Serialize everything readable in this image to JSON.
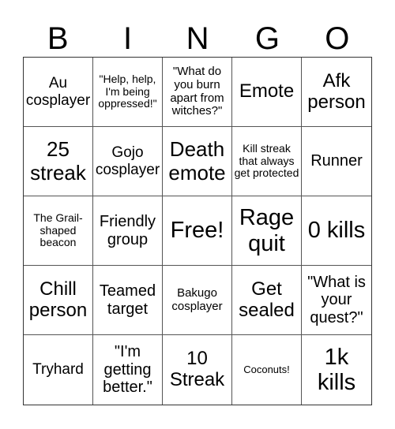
{
  "header": {
    "letters": [
      "B",
      "I",
      "N",
      "G",
      "O"
    ]
  },
  "cells": [
    "Au cosplayer",
    "\"Help, help, I'm being oppressed!\"",
    "\"What do you burn apart from witches?\"",
    "Emote",
    "Afk person",
    "25 streak",
    "Gojo cosplayer",
    "Death emote",
    "Kill streak that always get protected",
    "Runner",
    "The Grail-shaped beacon",
    "Friendly group",
    "Free!",
    "Rage quit",
    "0 kills",
    "Chill person",
    "Teamed target",
    "Bakugo cosplayer",
    "Get sealed",
    "\"What is your quest?\"",
    "Tryhard",
    "\"I'm getting better.\"",
    "10 Streak",
    "Coconuts!",
    "1k kills"
  ]
}
